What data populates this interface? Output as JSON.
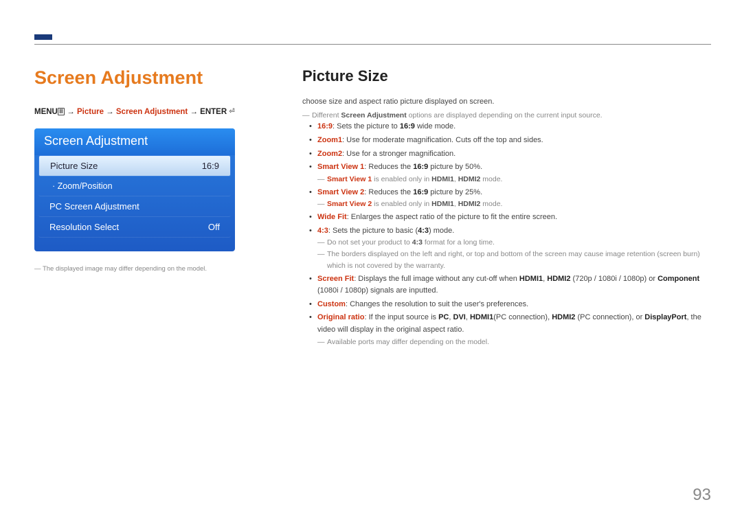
{
  "page_number": "93",
  "left": {
    "heading": "Screen Adjustment",
    "breadcrumb": {
      "menu_label": "MENU",
      "arrow": " → ",
      "p1": "Picture",
      "p2": "Screen Adjustment",
      "enter_label": "ENTER"
    },
    "menu": {
      "title": "Screen Adjustment",
      "items": [
        {
          "label": "Picture Size",
          "value": "16:9",
          "highlighted": true
        },
        {
          "label": "· Zoom/Position",
          "value": "",
          "highlighted": false
        },
        {
          "label": "PC Screen Adjustment",
          "value": "",
          "highlighted": false
        },
        {
          "label": "Resolution Select",
          "value": "Off",
          "highlighted": false
        }
      ]
    },
    "disclaimer": "The displayed image may differ depending on the model."
  },
  "right": {
    "heading": "Picture Size",
    "intro": "choose size and aspect ratio picture displayed on screen.",
    "intro_note_pre": "Different ",
    "intro_note_bold": "Screen Adjustment",
    "intro_note_post": " options are displayed depending on the current input source.",
    "items": {
      "i1_key": "16:9",
      "i1_txt_a": ": Sets the picture to ",
      "i1_em": "16:9",
      "i1_txt_b": " wide mode.",
      "i2_key": "Zoom1",
      "i2_txt": ": Use for moderate magnification. Cuts off the top and sides.",
      "i3_key": "Zoom2",
      "i3_txt": ": Use for a stronger magnification.",
      "i4_key": "Smart View 1",
      "i4_txt_a": ": Reduces the ",
      "i4_em": "16:9",
      "i4_txt_b": " picture by 50%.",
      "i4_note_a": "Smart View 1",
      "i4_note_b": " is enabled only in ",
      "i4_note_c": "HDMI1",
      "i4_note_d": ", ",
      "i4_note_e": "HDMI2",
      "i4_note_f": " mode.",
      "i5_key": "Smart View 2",
      "i5_txt_a": ": Reduces the ",
      "i5_em": "16:9",
      "i5_txt_b": " picture by 25%.",
      "i5_note_a": "Smart View 2",
      "i5_note_b": " is enabled only in ",
      "i5_note_c": "HDMI1",
      "i5_note_d": ", ",
      "i5_note_e": "HDMI2",
      "i5_note_f": " mode.",
      "i6_key": "Wide Fit",
      "i6_txt": ": Enlarges the aspect ratio of the picture to fit the entire screen.",
      "i7_key": "4:3",
      "i7_txt_a": ": Sets the picture to basic (",
      "i7_em": "4:3",
      "i7_txt_b": ") mode.",
      "i7_note1_a": "Do not set your product to ",
      "i7_note1_b": "4:3",
      "i7_note1_c": " format for a long time.",
      "i7_note2": "The borders displayed on the left and right, or top and bottom of the screen may cause image retention (screen burn) which is not covered by the warranty.",
      "i8_key": "Screen Fit",
      "i8_txt_a": ": Displays the full image without any cut-off when ",
      "i8_b1": "HDMI1",
      "i8_c1": ", ",
      "i8_b2": "HDMI2",
      "i8_c2": " (720p / 1080i / 1080p) or ",
      "i8_b3": "Component",
      "i8_c3": " (1080i / 1080p) signals are inputted.",
      "i9_key": "Custom",
      "i9_txt": ": Changes the resolution to suit the user's preferences.",
      "i10_key": "Original ratio",
      "i10_a": ": If the input source is ",
      "i10_b1": "PC",
      "i10_c1": ", ",
      "i10_b2": "DVI",
      "i10_c2": ", ",
      "i10_b3": "HDMI1",
      "i10_c3": "(PC connection), ",
      "i10_b4": "HDMI2",
      "i10_c4": " (PC connection), or ",
      "i10_b5": "DisplayPort",
      "i10_c5": ", the video will display in the original aspect ratio.",
      "i10_note": "Available ports may differ depending on the model."
    }
  }
}
